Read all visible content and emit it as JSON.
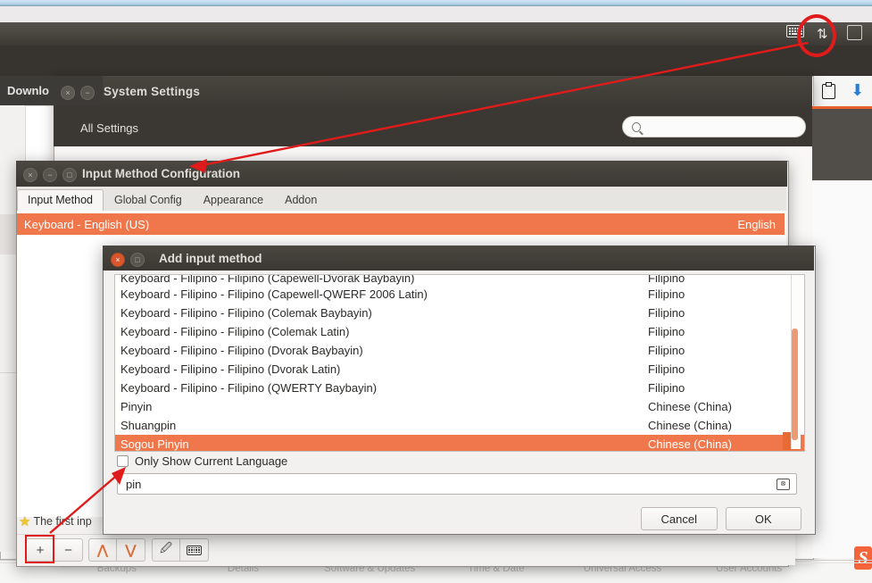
{
  "panel": {
    "icons": [
      {
        "name": "keyboard-indicator-icon",
        "glyph": "keyboard"
      },
      {
        "name": "network-indicator-icon",
        "glyph": "⇅"
      },
      {
        "name": "bluetooth-indicator-icon",
        "glyph": "square"
      }
    ],
    "highlight_color": "#e01b1b"
  },
  "downloads_window": {
    "title": "Downlo"
  },
  "system_settings": {
    "title": "System Settings",
    "all_settings_label": "All Settings",
    "search": {
      "value": "",
      "placeholder": ""
    },
    "right_icons": [
      {
        "name": "clipboard-icon"
      },
      {
        "name": "download-arrow-icon"
      }
    ],
    "category_labels": [
      "Backups",
      "Details",
      "Software & Updates",
      "Time & Date",
      "Universal Access",
      "User Accounts"
    ],
    "accent_color": "#e8612c"
  },
  "input_method_config": {
    "title": "Input Method Configuration",
    "tabs": [
      {
        "label": "Input Method",
        "active": true
      },
      {
        "label": "Global Config",
        "active": false
      },
      {
        "label": "Appearance",
        "active": false
      },
      {
        "label": "Addon",
        "active": false
      }
    ],
    "selected_row": {
      "name": "Keyboard - English (US)",
      "language": "English"
    },
    "footer_note": "The first inp",
    "toolbar": [
      {
        "name": "add-button",
        "label": "+"
      },
      {
        "name": "remove-button",
        "label": "−"
      },
      {
        "name": "move-up-button",
        "label": "⌃"
      },
      {
        "name": "move-down-button",
        "label": "⌄"
      },
      {
        "name": "configure-button",
        "label": "wand"
      },
      {
        "name": "keyboard-button",
        "label": "keyboard"
      }
    ],
    "selection_color": "#f0774b"
  },
  "add_input_method": {
    "title": "Add input method",
    "list": [
      {
        "name": "Keyboard - Filipino - Filipino (Capewell-Dvorak Baybayin)",
        "language": "Filipino",
        "clipped": true,
        "selected": false
      },
      {
        "name": "Keyboard - Filipino - Filipino (Capewell-QWERF 2006 Latin)",
        "language": "Filipino",
        "clipped": false,
        "selected": false
      },
      {
        "name": "Keyboard - Filipino - Filipino (Colemak Baybayin)",
        "language": "Filipino",
        "clipped": false,
        "selected": false
      },
      {
        "name": "Keyboard - Filipino - Filipino (Colemak Latin)",
        "language": "Filipino",
        "clipped": false,
        "selected": false
      },
      {
        "name": "Keyboard - Filipino - Filipino (Dvorak Baybayin)",
        "language": "Filipino",
        "clipped": false,
        "selected": false
      },
      {
        "name": "Keyboard - Filipino - Filipino (Dvorak Latin)",
        "language": "Filipino",
        "clipped": false,
        "selected": false
      },
      {
        "name": "Keyboard - Filipino - Filipino (QWERTY Baybayin)",
        "language": "Filipino",
        "clipped": false,
        "selected": false
      },
      {
        "name": "Pinyin",
        "language": "Chinese (China)",
        "clipped": false,
        "selected": false
      },
      {
        "name": "Shuangpin",
        "language": "Chinese (China)",
        "clipped": false,
        "selected": false
      },
      {
        "name": "Sogou Pinyin",
        "language": "Chinese (China)",
        "clipped": false,
        "selected": true
      }
    ],
    "only_current_language": {
      "label": "Only Show Current Language",
      "checked": false
    },
    "search": {
      "value": "pin",
      "placeholder": ""
    },
    "cancel_label": "Cancel",
    "ok_label": "OK"
  }
}
